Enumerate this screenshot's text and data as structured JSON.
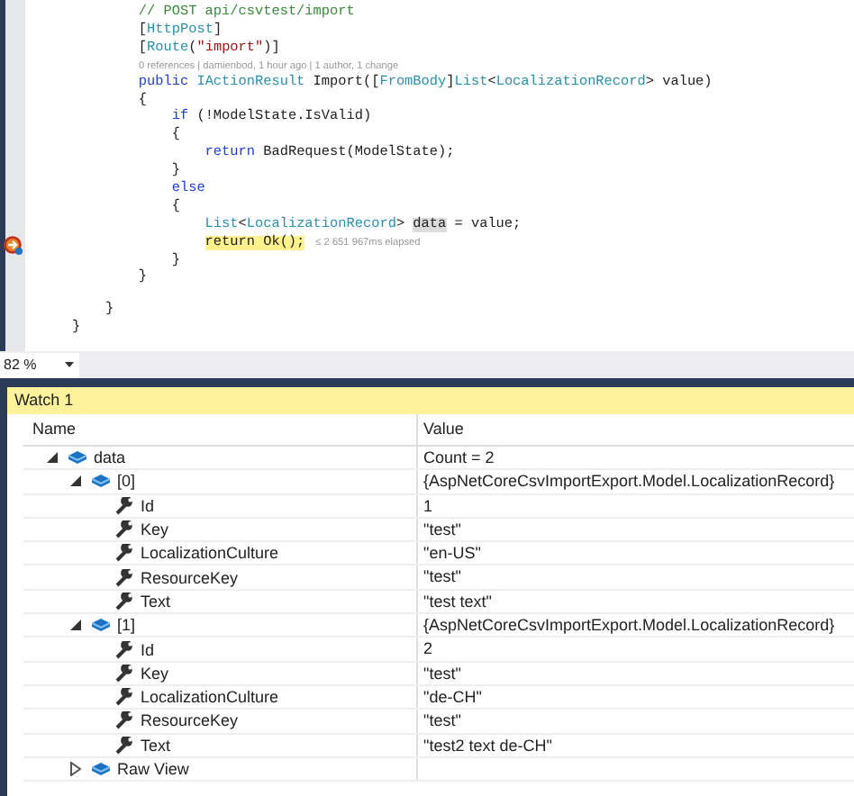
{
  "editor": {
    "lines": [
      {
        "kind": "code",
        "tokens": [
          {
            "kind": "comment",
            "text": "        // POST api/csvtest/import"
          }
        ]
      },
      {
        "kind": "code",
        "tokens": [
          {
            "kind": "plain",
            "text": "        ["
          },
          {
            "kind": "type",
            "text": "HttpPost"
          },
          {
            "kind": "plain",
            "text": "]"
          }
        ]
      },
      {
        "kind": "code",
        "tokens": [
          {
            "kind": "plain",
            "text": "        ["
          },
          {
            "kind": "type",
            "text": "Route"
          },
          {
            "kind": "plain",
            "text": "("
          },
          {
            "kind": "string",
            "text": "\"import\""
          },
          {
            "kind": "plain",
            "text": ")]"
          }
        ]
      },
      {
        "kind": "codelens",
        "tokens": [
          {
            "kind": "codelens",
            "text": "0 references | damienbod, 1 hour ago | 1 author, 1 change"
          }
        ]
      },
      {
        "kind": "code",
        "tokens": [
          {
            "kind": "keyword",
            "text": "        public "
          },
          {
            "kind": "type",
            "text": "IActionResult"
          },
          {
            "kind": "plain",
            "text": " Import(["
          },
          {
            "kind": "type",
            "text": "FromBody"
          },
          {
            "kind": "plain",
            "text": "]"
          },
          {
            "kind": "type",
            "text": "List"
          },
          {
            "kind": "plain",
            "text": "<"
          },
          {
            "kind": "type",
            "text": "LocalizationRecord"
          },
          {
            "kind": "plain",
            "text": "> value)"
          }
        ]
      },
      {
        "kind": "code",
        "tokens": [
          {
            "kind": "plain",
            "text": "        {"
          }
        ]
      },
      {
        "kind": "code",
        "tokens": [
          {
            "kind": "keyword",
            "text": "            if"
          },
          {
            "kind": "plain",
            "text": " (!ModelState.IsValid)"
          }
        ]
      },
      {
        "kind": "code",
        "tokens": [
          {
            "kind": "plain",
            "text": "            {"
          }
        ]
      },
      {
        "kind": "code",
        "tokens": [
          {
            "kind": "keyword",
            "text": "                return"
          },
          {
            "kind": "plain",
            "text": " BadRequest(ModelState);"
          }
        ]
      },
      {
        "kind": "code",
        "tokens": [
          {
            "kind": "plain",
            "text": "            }"
          }
        ]
      },
      {
        "kind": "code",
        "tokens": [
          {
            "kind": "keyword",
            "text": "            else"
          }
        ]
      },
      {
        "kind": "code",
        "tokens": [
          {
            "kind": "plain",
            "text": "            {"
          }
        ]
      },
      {
        "kind": "code",
        "tokens": [
          {
            "kind": "type",
            "text": "                List"
          },
          {
            "kind": "plain",
            "text": "<"
          },
          {
            "kind": "type",
            "text": "LocalizationRecord"
          },
          {
            "kind": "plain",
            "text": "> "
          },
          {
            "kind": "selected-word",
            "text": "data"
          },
          {
            "kind": "plain",
            "text": " = value;"
          }
        ]
      },
      {
        "kind": "current",
        "tokens": [
          {
            "kind": "current-statement",
            "text": "return Ok();"
          },
          {
            "kind": "perf-tip",
            "text": "≤ 2 651 967ms elapsed"
          }
        ]
      },
      {
        "kind": "code",
        "tokens": [
          {
            "kind": "plain",
            "text": "            }"
          }
        ]
      },
      {
        "kind": "code",
        "tokens": [
          {
            "kind": "plain",
            "text": "        }"
          }
        ]
      },
      {
        "kind": "blank"
      },
      {
        "kind": "code",
        "tokens": [
          {
            "kind": "plain",
            "text": "    }"
          }
        ]
      },
      {
        "kind": "code",
        "tokens": [
          {
            "kind": "plain",
            "text": "}"
          }
        ]
      }
    ]
  },
  "zoom": {
    "value": "82 %"
  },
  "watch": {
    "title": "Watch 1",
    "columns": [
      "Name",
      "Value"
    ],
    "rows": [
      {
        "name": "data",
        "value": "Count = 2",
        "kind": "object",
        "expanded": true,
        "children": [
          {
            "name": "[0]",
            "value": "{AspNetCoreCsvImportExport.Model.LocalizationRecord}",
            "kind": "object",
            "expanded": true,
            "children": [
              {
                "name": "Id",
                "value": "1",
                "kind": "property"
              },
              {
                "name": "Key",
                "value": "\"test\"",
                "kind": "property"
              },
              {
                "name": "LocalizationCulture",
                "value": "\"en-US\"",
                "kind": "property"
              },
              {
                "name": "ResourceKey",
                "value": "\"test\"",
                "kind": "property"
              },
              {
                "name": "Text",
                "value": "\"test text\"",
                "kind": "property"
              }
            ]
          },
          {
            "name": "[1]",
            "value": "{AspNetCoreCsvImportExport.Model.LocalizationRecord}",
            "kind": "object",
            "expanded": true,
            "children": [
              {
                "name": "Id",
                "value": "2",
                "kind": "property"
              },
              {
                "name": "Key",
                "value": "\"test\"",
                "kind": "property"
              },
              {
                "name": "LocalizationCulture",
                "value": "\"de-CH\"",
                "kind": "property"
              },
              {
                "name": "ResourceKey",
                "value": "\"test\"",
                "kind": "property"
              },
              {
                "name": "Text",
                "value": "\"test2 text de-CH\"",
                "kind": "property"
              }
            ]
          },
          {
            "name": "Raw View",
            "kind": "object",
            "expanded": false
          }
        ]
      }
    ]
  }
}
